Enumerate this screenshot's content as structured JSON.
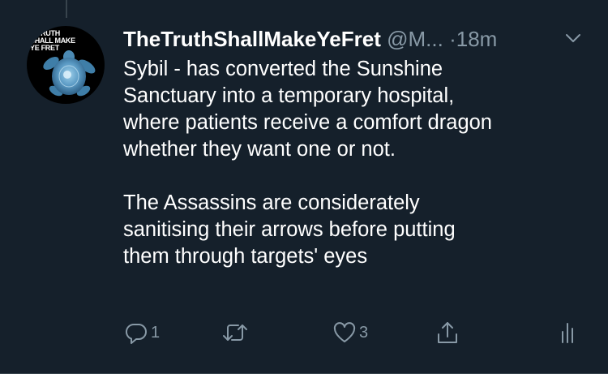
{
  "tweet": {
    "avatar_text": "E TRUTH\nSHALL MAKE\nYE FRET",
    "display_name": "TheTruthShallMakeYeFret",
    "handle": "@M...",
    "separator": "·",
    "time": "18m",
    "text": "Sybil - has converted the Sunshine\nSanctuary into a temporary hospital,\nwhere patients receive a comfort dragon\nwhether they want one or not.\n\nThe Assassins are considerately\nsanitising their arrows before putting\nthem through targets' eyes"
  },
  "actions": {
    "reply": {
      "icon": "reply-icon",
      "count": "1"
    },
    "retweet": {
      "icon": "retweet-icon",
      "count": ""
    },
    "like": {
      "icon": "heart-icon",
      "count": "3"
    },
    "share": {
      "icon": "share-icon"
    },
    "analytics": {
      "icon": "analytics-icon"
    }
  },
  "colors": {
    "background": "#15202b",
    "text": "#ffffff",
    "muted": "#8899a6",
    "line": "#38444d",
    "avatar_accent": "#5a9ac4"
  }
}
